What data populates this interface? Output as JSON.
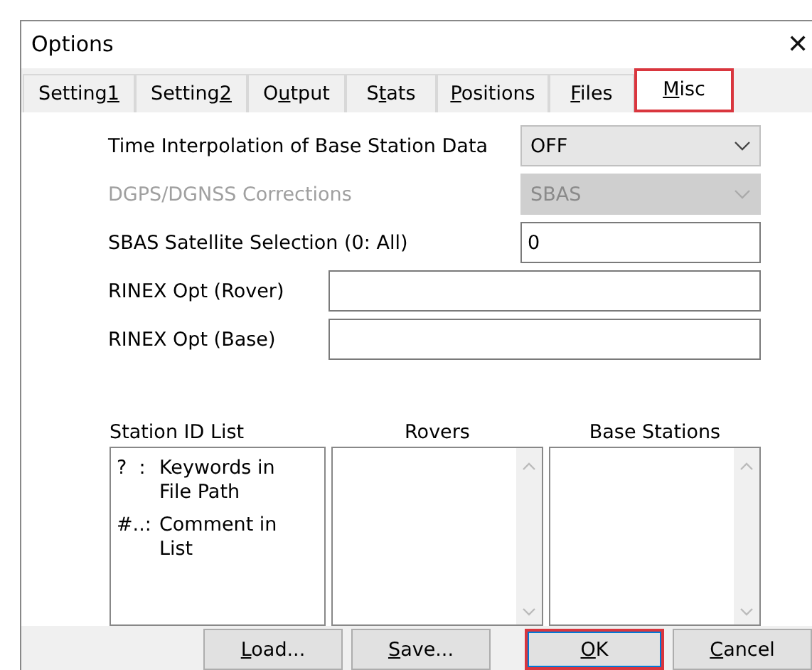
{
  "window": {
    "title": "Options",
    "close": "✕"
  },
  "tabs": [
    {
      "before": "Setting",
      "key": "1",
      "selected": false
    },
    {
      "before": "Setting",
      "key": "2",
      "selected": false
    },
    {
      "before": "O",
      "key": "u",
      "after": "tput",
      "selected": false
    },
    {
      "before": "S",
      "key": "t",
      "after": "ats",
      "selected": false
    },
    {
      "key": "P",
      "after": "ositions",
      "selected": false
    },
    {
      "key": "F",
      "after": "iles",
      "selected": false
    },
    {
      "key": "M",
      "after": "isc",
      "selected": true
    }
  ],
  "fields": [
    {
      "kind": "dropdown",
      "label": "Time Interpolation of Base Station Data",
      "value": "OFF",
      "disabled": false
    },
    {
      "kind": "dropdown",
      "label": "DGPS/DGNSS Corrections",
      "value": "SBAS",
      "disabled": true
    },
    {
      "kind": "text",
      "label": "SBAS Satellite Selection (0: All)",
      "value": "0",
      "disabled": false
    },
    {
      "kind": "wide-text",
      "label": "RINEX Opt (Rover)",
      "disabled": false
    },
    {
      "kind": "wide-text",
      "label": "RINEX Opt (Base)",
      "disabled": false
    }
  ],
  "station_id_list": {
    "title": "Station ID List",
    "items": [
      {
        "key": "?  :",
        "text": "Keywords in File Path"
      },
      {
        "key": "#..:",
        "text": "Comment in List"
      }
    ]
  },
  "lists": [
    {
      "title": "Rovers"
    },
    {
      "title": "Base Stations"
    }
  ],
  "buttons": [
    {
      "key": "L",
      "after": "oad...",
      "selected": false
    },
    {
      "key": "S",
      "after": "ave...",
      "selected": false
    },
    {
      "key": "O",
      "after": "K",
      "selected": true
    },
    {
      "key": "C",
      "after": "ancel",
      "selected": false
    }
  ]
}
